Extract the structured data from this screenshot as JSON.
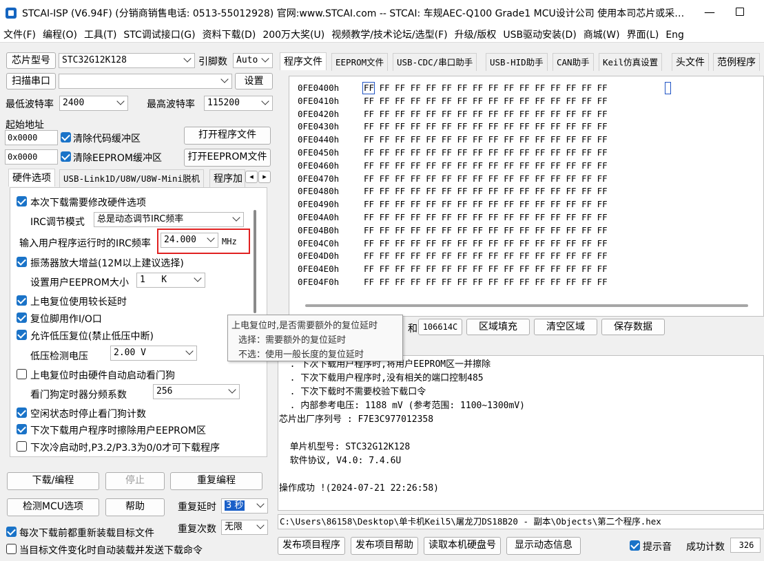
{
  "window": {
    "title": "STCAI-ISP (V6.94F) (分销商销售电话: 0513-55012928) 官网:www.STCAI.com  -- STCAI: 车规AEC-Q100 Grade1 MCU设计公司 使用本司芯片或采…",
    "minimize_glyph": "—"
  },
  "menu": [
    "文件(F)",
    "编程(O)",
    "工具(T)",
    "STC调试接口(G)",
    "资料下载(D)",
    "200万大奖(U)",
    "视频教学/技术论坛/选型(F)",
    "升级/版权",
    "USB驱动安装(D)",
    "商城(W)",
    "界面(L)",
    "Eng"
  ],
  "left": {
    "chip_model_btn": "芯片型号",
    "chip_model_value": "STC32G12K128",
    "pin_count_label": "引脚数",
    "pin_count_value": "Auto",
    "scan_port_btn": "扫描串口",
    "port_value": "",
    "settings_btn": "设置",
    "min_baud_label": "最低波特率",
    "min_baud_value": "2400",
    "max_baud_label": "最高波特率",
    "max_baud_value": "115200",
    "start_addr_label": "起始地址",
    "addr1": "0x0000",
    "addr2": "0x0000",
    "clear_code_label": "清除代码缓冲区",
    "clear_eeprom_label": "清除EEPROM缓冲区",
    "open_prog_btn": "打开程序文件",
    "open_eeprom_btn": "打开EEPROM文件",
    "tabs": [
      "硬件选项",
      "USB-Link1D/U8W/U8W-Mini脱机",
      "程序加"
    ],
    "tab_left": "◂",
    "tab_right": "▸"
  },
  "hw": {
    "modify_hw": "本次下载需要修改硬件选项",
    "irc_mode_label": "IRC调节模式",
    "irc_mode_value": "总是动态调节IRC频率",
    "irc_freq_label": "输入用户程序运行时的IRC频率",
    "irc_freq_value": "24.000",
    "irc_unit": "MHz",
    "osc_gain": "振荡器放大增益(12M以上建议选择)",
    "eeprom_size_label": "设置用户EEPROM大小",
    "eeprom_size_value": "1   K",
    "long_reset": "上电复位使用较长延时",
    "reset_io": "复位脚用作I/O口",
    "lvd_reset": "允许低压复位(禁止低压中断)",
    "lvd_label": "低压检测电压",
    "lvd_value": "2.00 V",
    "wdt_auto": "上电复位时由硬件自动启动看门狗",
    "wdt_div_label": "看门狗定时器分频系数",
    "wdt_div_value": "256",
    "idle_stop_wdt": "空闲状态时停止看门狗计数",
    "erase_eeprom": "下次下载用户程序时擦除用户EEPROM区",
    "cold_boot": "下次冷启动时,P3.2/P3.3为0/0才可下载程序"
  },
  "bottom_left": {
    "download_btn": "下载/编程",
    "stop_btn": "停止",
    "reprogram_btn": "重复编程",
    "check_mcu_btn": "检测MCU选项",
    "help_btn": "帮助",
    "repeat_delay_label": "重复延时",
    "repeat_delay_value": "3 秒",
    "reload_label": "每次下载前都重新装载目标文件",
    "repeat_count_label": "重复次数",
    "repeat_count_value": "无限",
    "auto_send_label": "当目标文件变化时自动装载并发送下载命令"
  },
  "right_tabs": [
    "程序文件",
    "EEPROM文件",
    "USB-CDC/串口助手",
    "USB-HID助手",
    "CAN助手",
    "Keil仿真设置",
    "头文件",
    "范例程序"
  ],
  "hex": {
    "addresses": [
      "0FE0400h",
      "0FE0410h",
      "0FE0420h",
      "0FE0430h",
      "0FE0440h",
      "0FE0450h",
      "0FE0460h",
      "0FE0470h",
      "0FE0480h",
      "0FE0490h",
      "0FE04A0h",
      "0FE04B0h",
      "0FE04C0h",
      "0FE04D0h",
      "0FE04E0h",
      "0FE04F0h"
    ],
    "bytes": "FF FF FF FF FF FF FF FF FF FF FF FF FF FF FF FF"
  },
  "hex_bar": {
    "checksum_label": "和",
    "checksum_value": "106614C",
    "fill_btn": "区域填充",
    "clear_btn": "清空区域",
    "save_btn": "保存数据"
  },
  "tooltip": {
    "line1": "上电复位时,是否需要额外的复位延时",
    "line2": "选择：需要额外的复位延时",
    "line3": "不选：使用一般长度的复位延时"
  },
  "log": {
    "lines": [
      "  . 下次下载用户程序时,将用户EEPROM区一并擦除",
      "  . 下次下载用户程序时,没有相关的端口控制485",
      "  . 下次下载时不需要校验下载口令",
      "  . 内部参考电压: 1188 mV (参考范围: 1100~1300mV)",
      "芯片出厂序列号 : F7E3C977012358",
      "",
      "  单片机型号: STC32G12K128",
      "  软件协议, V4.0: 7.4.6U",
      "",
      "操作成功 !(2024-07-21 22:26:58)"
    ]
  },
  "path": "C:\\Users\\86158\\Desktop\\单卡机Keil5\\屠龙刀DS18B20 - 副本\\Objects\\第二个程序.hex",
  "bottom_right": {
    "publish_btn": "发布项目程序",
    "publish_help_btn": "发布项目帮助",
    "read_disk_btn": "读取本机硬盘号",
    "show_info_btn": "显示动态信息",
    "beep_label": "提示音",
    "success_label": "成功计数",
    "success_value": "326"
  }
}
